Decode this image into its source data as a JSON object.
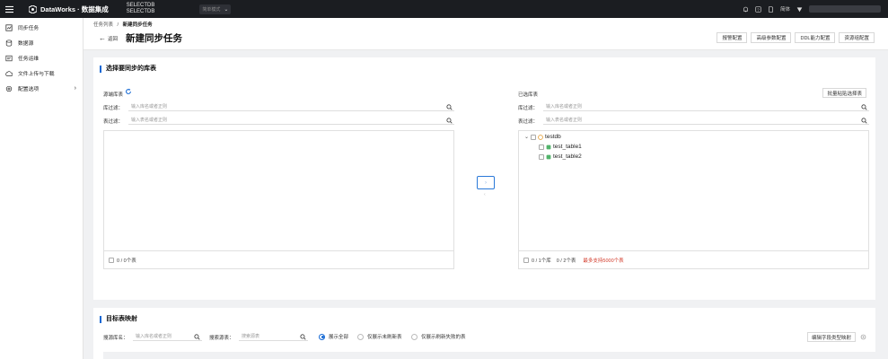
{
  "topbar": {
    "brand": "DataWorks · 数据集成",
    "project_line1": "SELECTDB",
    "project_line2": "SELECTDB",
    "mode": "简单模式",
    "lang": "简体"
  },
  "sidebar": {
    "items": [
      {
        "label": "同步任务",
        "icon": "sync-task-icon"
      },
      {
        "label": "数据源",
        "icon": "database-icon"
      },
      {
        "label": "任务运维",
        "icon": "ops-icon"
      },
      {
        "label": "文件上传与下载",
        "icon": "file-transfer-icon"
      },
      {
        "label": "配置选项",
        "icon": "settings-icon"
      }
    ]
  },
  "header": {
    "breadcrumb_parent": "任务列表",
    "breadcrumb_sep": "/",
    "breadcrumb_current": "新建同步任务",
    "back_label": "返回",
    "title": "新建同步任务",
    "buttons": [
      "报警配置",
      "高级参数配置",
      "DDL能力配置",
      "资源组配置"
    ]
  },
  "select_section": {
    "title": "选择要同步的库表",
    "source": {
      "label": "源端库表",
      "db_filter_label": "库过滤：",
      "db_filter_placeholder": "输入库名或者正则",
      "table_filter_label": "表过滤：",
      "table_filter_placeholder": "输入表名或者正则",
      "footer_count": "0 / 0个表"
    },
    "selected": {
      "label": "已选库表",
      "batch_paste": "批量粘贴选择表",
      "db_filter_label": "库过滤：",
      "db_filter_placeholder": "输入库名或者正则",
      "table_filter_label": "表过滤：",
      "table_filter_placeholder": "输入表名或者正则",
      "tree": {
        "db": "testdb",
        "tables": [
          "test_table1",
          "test_table2"
        ]
      },
      "footer_db_count": "0 / 1个库",
      "footer_table_count": "0 / 2个表",
      "footer_limit": "最多支持5000个表"
    },
    "transfer_symbol": "›",
    "transfer_symbol_back": "‹"
  },
  "mapping_section": {
    "title": "目标表映射",
    "source_db_label": "搜源库名：",
    "source_db_placeholder": "输入库名或者正则",
    "source_table_label": "搜索源表：",
    "source_table_placeholder": "搜索源表",
    "radio_options": [
      "展示全部",
      "仅展示未刷新表",
      "仅展示刷新失败的表"
    ],
    "edit_button": "编辑字段类型映射"
  },
  "colors": {
    "accent": "#1468d4",
    "topbar_bg": "#1b1d21",
    "warning": "#d23a2a"
  }
}
